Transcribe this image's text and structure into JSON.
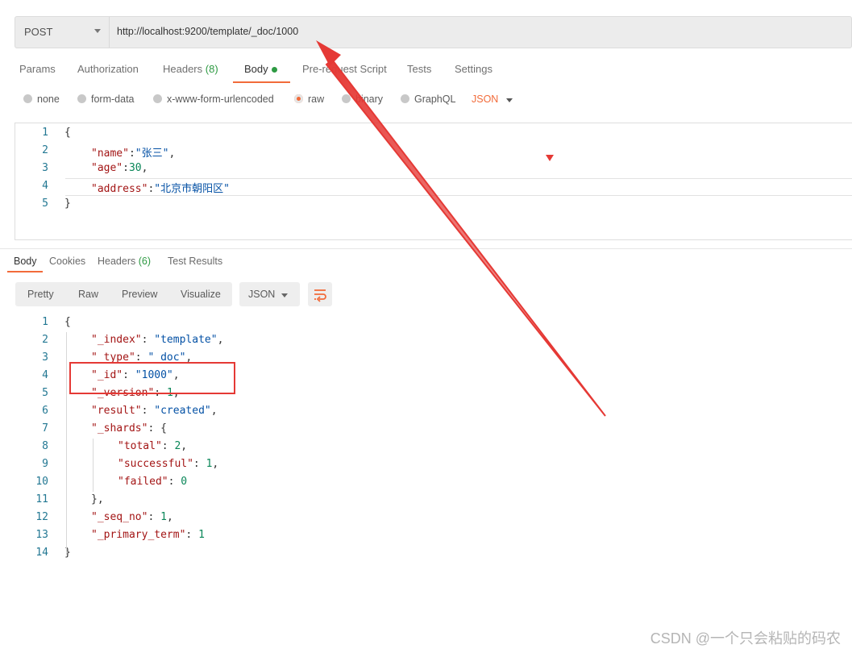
{
  "request": {
    "method": "POST",
    "url": "http://localhost:9200/template/_doc/1000"
  },
  "request_tabs": [
    {
      "label": "Params"
    },
    {
      "label": "Authorization"
    },
    {
      "label": "Headers",
      "count": "(8)"
    },
    {
      "label": "Body"
    },
    {
      "label": "Pre-request Script"
    },
    {
      "label": "Tests"
    },
    {
      "label": "Settings"
    }
  ],
  "body_types": {
    "none": "none",
    "form_data": "form-data",
    "urlencoded": "x-www-form-urlencoded",
    "raw": "raw",
    "binary": "binary",
    "graphql": "GraphQL",
    "selected": "raw",
    "format": "JSON"
  },
  "request_body": {
    "line_numbers": [
      "1",
      "2",
      "3",
      "4",
      "5"
    ],
    "lines": [
      {
        "p": "{"
      },
      {
        "k": "\"name\"",
        "sep": ":",
        "s": "\"张三\"",
        "end": ","
      },
      {
        "k": "\"age\"",
        "sep": ":",
        "n": "30",
        "end": ","
      },
      {
        "k": "\"address\"",
        "sep": ":",
        "s": "\"北京市朝阳区\""
      },
      {
        "p": "}"
      }
    ]
  },
  "response_tabs": [
    {
      "label": "Body"
    },
    {
      "label": "Cookies"
    },
    {
      "label": "Headers",
      "count": "(6)"
    },
    {
      "label": "Test Results"
    }
  ],
  "response_view": {
    "modes": [
      "Pretty",
      "Raw",
      "Preview",
      "Visualize"
    ],
    "format": "JSON"
  },
  "response_body": {
    "line_numbers": [
      "1",
      "2",
      "3",
      "4",
      "5",
      "6",
      "7",
      "8",
      "9",
      "10",
      "11",
      "12",
      "13",
      "14"
    ],
    "lines": [
      {
        "p": "{"
      },
      {
        "k": "\"_index\"",
        "sep": ": ",
        "s": "\"template\"",
        "end": ","
      },
      {
        "k": "\"_type\"",
        "sep": ": ",
        "s": "\"_doc\"",
        "end": ","
      },
      {
        "k": "\"_id\"",
        "sep": ": ",
        "s": "\"1000\"",
        "end": ","
      },
      {
        "k": "\"_version\"",
        "sep": ": ",
        "n": "1",
        "end": ","
      },
      {
        "k": "\"result\"",
        "sep": ": ",
        "s": "\"created\"",
        "end": ","
      },
      {
        "k": "\"_shards\"",
        "sep": ": ",
        "p": "{"
      },
      {
        "k": "\"total\"",
        "sep": ": ",
        "n": "2",
        "end": ","
      },
      {
        "k": "\"successful\"",
        "sep": ": ",
        "n": "1",
        "end": ","
      },
      {
        "k": "\"failed\"",
        "sep": ": ",
        "n": "0"
      },
      {
        "p": "},"
      },
      {
        "k": "\"_seq_no\"",
        "sep": ": ",
        "n": "1",
        "end": ","
      },
      {
        "k": "\"_primary_term\"",
        "sep": ": ",
        "n": "1"
      },
      {
        "p": "}"
      }
    ]
  },
  "watermark": "CSDN @一个只会粘贴的码农",
  "colors": {
    "accent": "#f26b3a",
    "success": "#2e9a43",
    "annotation": "#e53935"
  }
}
